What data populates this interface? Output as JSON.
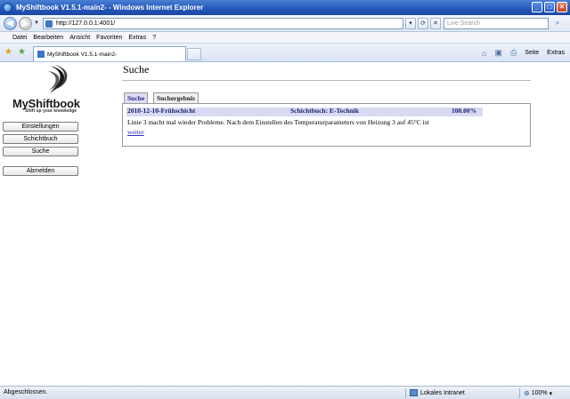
{
  "window": {
    "title": "MyShiftbook V1.5.1-main2- - Windows Internet Explorer",
    "minimize": "_",
    "maximize": "□",
    "close": "×"
  },
  "addressbar": {
    "url": "http://127.0.0.1:4001/",
    "search_placeholder": "Live Search"
  },
  "menu": {
    "items": [
      "Datei",
      "Bearbeiten",
      "Ansicht",
      "Favoriten",
      "Extras",
      "?"
    ]
  },
  "tabbar": {
    "tab_label": "MyShiftbook V1.5.1-main2-",
    "page_label": "Seite",
    "extras_label": "Extras"
  },
  "app": {
    "brand": "MyShiftbook",
    "tagline": "Shift up your knowledge",
    "nav": {
      "einstellungen": "Einstellungen",
      "schichtbuch": "Schichtbuch",
      "suche": "Suche",
      "abmelden": "Abmelden"
    },
    "page_title": "Suche",
    "tabs": [
      "Suche",
      "Suchergebnis"
    ],
    "result": {
      "header_date": "2010-12-10-Frühschicht",
      "header_book": "Schichtbuch: E-Technik",
      "header_score": "100.00%",
      "text": "Linie 3 macht mal wieder Probleme. Nach dem Einstellen des Temperaturparameters von Heizung 3 auf 45°C ist",
      "link": "weiter"
    }
  },
  "statusbar": {
    "status": "Abgeschlossen.",
    "zone": "Lokales Intranet",
    "zoom": "100%"
  }
}
